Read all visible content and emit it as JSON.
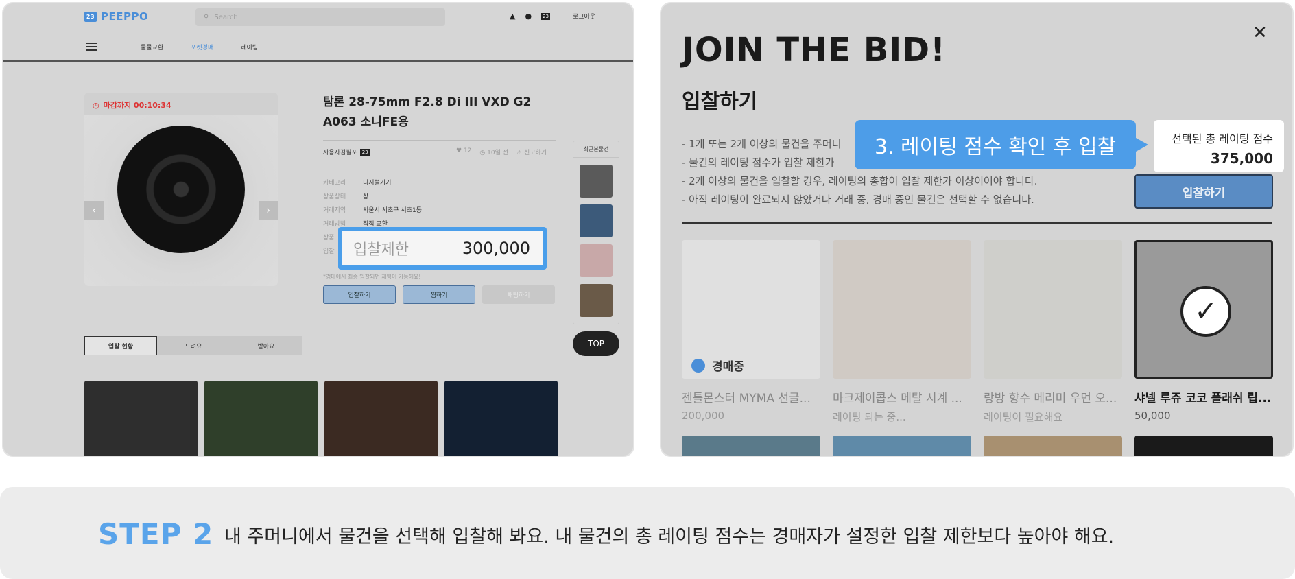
{
  "left": {
    "logo": "PEEPPO",
    "logo_badge": "23",
    "search_placeholder": "Search",
    "header_badge": "23",
    "login": "로그아웃",
    "nav": [
      "물물교환",
      "포켓경매",
      "레이팅"
    ],
    "deadline": "마감까지 00:10:34",
    "product_title": "탐론 28-75mm F2.8 Di III VXD G2 A063 소니FE용",
    "seller": "사용자김필포",
    "seller_badge": "23",
    "likes": "12",
    "time_ago": "10일 전",
    "report": "신고하기",
    "specs": [
      {
        "k": "카테고리",
        "v": "디지털기기"
      },
      {
        "k": "상품상태",
        "v": "상"
      },
      {
        "k": "거래지역",
        "v": "서울시 서초구 서초1동"
      },
      {
        "k": "거래방법",
        "v": "직접 교환"
      },
      {
        "k": "상품",
        "v": ""
      },
      {
        "k": "입찰",
        "v": ""
      }
    ],
    "limit_label": "입찰제한",
    "limit_value": "300,000",
    "note": "*경매에서 최종 입찰되면 채팅이 가능해요!",
    "buttons": [
      "입찰하기",
      "찜하기",
      "채팅하기"
    ],
    "recent_title": "최근본물건",
    "top": "TOP",
    "tabs": [
      "입찰 현황",
      "드려요",
      "받아요"
    ]
  },
  "right": {
    "title": "JOIN THE BID!",
    "subtitle": "입찰하기",
    "rules": [
      "- 1개 또는 2개 이상의 물건을 주머니",
      "- 물건의 레이팅 점수가 입찰 제한가",
      "- 2개 이상의 물건을 입찰할 경우, 레이팅의 총합이 입찰 제한가 이상이어야 합니다.",
      "- 아직 레이팅이 완료되지 않았거나 거래 중, 경매 중인 물건은 선택할 수 없습니다."
    ],
    "callout": "3. 레이팅 점수 확인 후 입찰",
    "score_label": "선택된 총 레이팅 점수",
    "score_value": "375,000",
    "bid_button": "입찰하기",
    "auction_badge": "경매중",
    "cards": [
      {
        "name": "젠틀몬스터 MYMA 선글...",
        "sub": "200,000"
      },
      {
        "name": "마크제이콥스 메탈 시계 ...",
        "sub": "레이팅 되는 중..."
      },
      {
        "name": "랑방 향수 메리미 우먼 오...",
        "sub": "레이팅이 필요해요"
      },
      {
        "name": "샤넬 루쥬 코코 플래쉬 립...",
        "sub": "50,000"
      }
    ]
  },
  "bottom": {
    "step": "STEP 2",
    "desc": "내 주머니에서 물건을 선택해 입찰해 봐요. 내 물건의 총 레이팅 점수는 경매자가 설정한 입찰 제한보다 높아야 해요."
  },
  "colors": {
    "accent": "#4d9de8",
    "step": "#5aa4ea"
  }
}
